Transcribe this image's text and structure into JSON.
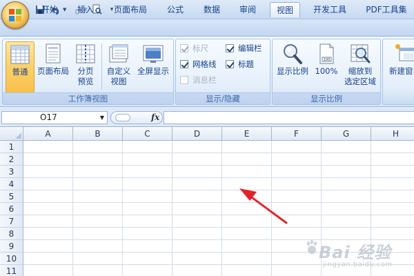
{
  "quick_access": {
    "save_icon": "save-icon",
    "undo_icon": "undo-icon",
    "redo_icon": "redo-icon",
    "print_preview_icon": "print-preview-icon",
    "customize_icon": "customize-arrow-icon"
  },
  "tabs": [
    {
      "label": "开始"
    },
    {
      "label": "插入"
    },
    {
      "label": "页面布局"
    },
    {
      "label": "公式"
    },
    {
      "label": "数据"
    },
    {
      "label": "审阅"
    },
    {
      "label": "视图",
      "active": true
    },
    {
      "label": "开发工具"
    },
    {
      "label": "PDF工具集"
    }
  ],
  "ribbon": {
    "workbook_views": {
      "label": "工作簿视图",
      "normal": [
        "普通"
      ],
      "page_layout": [
        "页面布局"
      ],
      "page_break": [
        "分页",
        "预览"
      ],
      "custom": [
        "自定义",
        "视图"
      ],
      "fullscreen": [
        "全屏显示"
      ]
    },
    "show_hide": {
      "label": "显示/隐藏",
      "ruler": "标尺",
      "gridlines": "网格线",
      "message_bar": "消息栏",
      "formula_bar": "编辑栏",
      "headings": "标题"
    },
    "zoom": {
      "label": "显示比例",
      "zoom": [
        "显示比例"
      ],
      "hundred": [
        "100%"
      ],
      "zoom_selection": [
        "缩放到",
        "选定区域"
      ]
    },
    "window": {
      "new_window": [
        "新建窗口"
      ]
    }
  },
  "formula_bar": {
    "name_box": "O17",
    "fx": "fx",
    "formula": ""
  },
  "grid": {
    "columns": [
      "A",
      "B",
      "C",
      "D",
      "E",
      "F",
      "G",
      "H"
    ],
    "rows": [
      "1",
      "2",
      "3",
      "4",
      "5",
      "6",
      "7",
      "8",
      "9",
      "10",
      "11"
    ]
  },
  "watermark": {
    "text": "Bai 经验",
    "sub": "jingyan.baidu.com"
  },
  "colors": {
    "accent": "#15428b",
    "selected": "#f9c04b",
    "arrow": "#e0242a"
  }
}
